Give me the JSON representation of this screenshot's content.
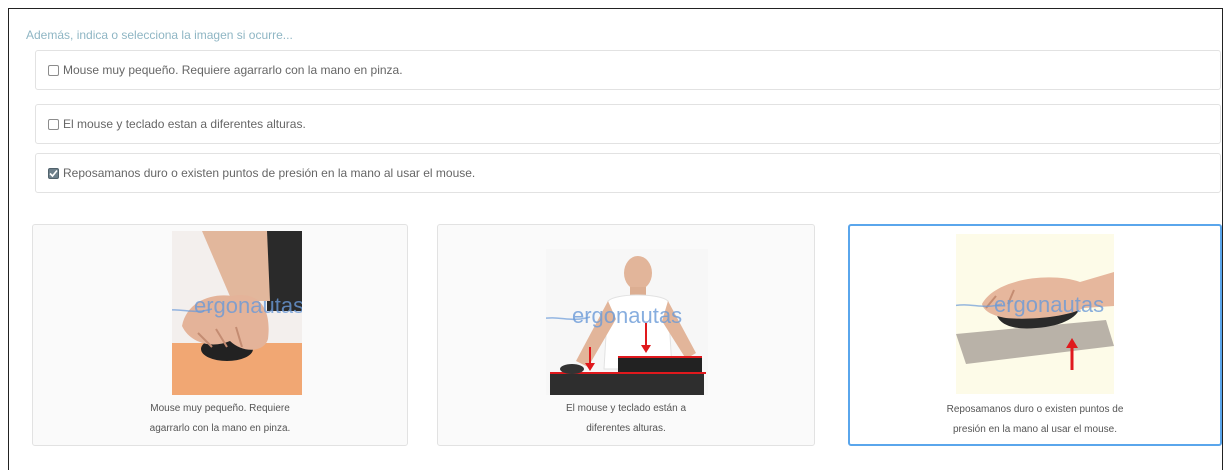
{
  "instruction": "Además, indica o selecciona la imagen si ocurre...",
  "options": [
    {
      "label": "Mouse muy pequeño. Requiere agarrarlo con la mano en pinza.",
      "checked": false
    },
    {
      "label": "El mouse y teclado estan a diferentes alturas.",
      "checked": false
    },
    {
      "label": "Reposamanos duro o existen puntos de presión en la mano al usar el mouse.",
      "checked": true
    }
  ],
  "cards": [
    {
      "caption_line1": "Mouse muy pequeño. Requiere",
      "caption_line2": "agarrarlo con la mano en pinza.",
      "watermark": "ergonautas",
      "selected": false
    },
    {
      "caption_line1": "El mouse y teclado están a",
      "caption_line2": "diferentes alturas.",
      "watermark": "ergonautas",
      "selected": false
    },
    {
      "caption_line1": "Reposamanos duro o existen puntos de",
      "caption_line2": "presión en la mano al usar el mouse.",
      "watermark": "ergonautas",
      "selected": true
    }
  ],
  "colors": {
    "accent": "#5aa6ec",
    "arrow": "#e0191d",
    "watermark": "#6a9ad8"
  }
}
